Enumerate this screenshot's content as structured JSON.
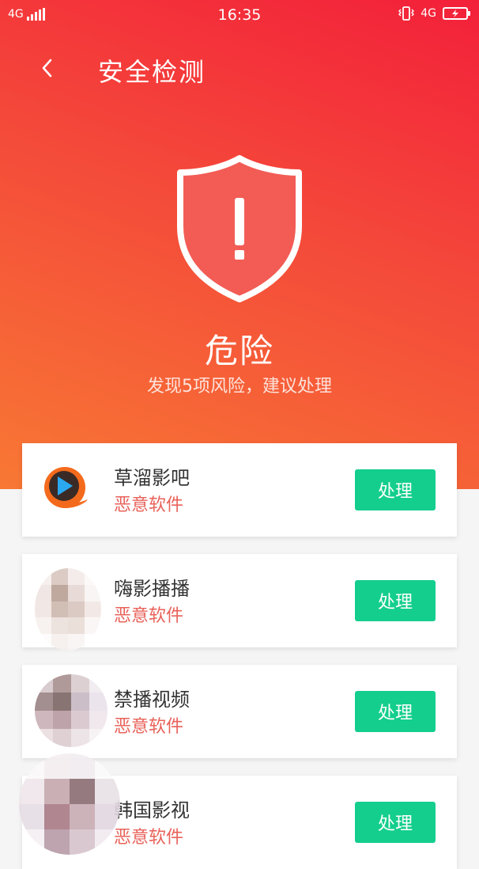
{
  "status_bar": {
    "network_left": "4G",
    "time": "16:35",
    "network_right": "4G"
  },
  "nav": {
    "title": "安全检测"
  },
  "summary": {
    "status": "危险",
    "message": "发现5项风险，建议处理"
  },
  "risk_items": [
    {
      "name": "草溜影吧",
      "type": "恶意软件",
      "action": "处理"
    },
    {
      "name": "嗨影播播",
      "type": "恶意软件",
      "action": "处理"
    },
    {
      "name": "禁播视频",
      "type": "恶意软件",
      "action": "处理"
    },
    {
      "name": "韩国影视",
      "type": "恶意软件",
      "action": "处理"
    }
  ],
  "colors": {
    "danger_red": "#f3203a",
    "accent_orange": "#f87834",
    "risk_text": "#e8625a",
    "action_green": "#14ce8e"
  }
}
